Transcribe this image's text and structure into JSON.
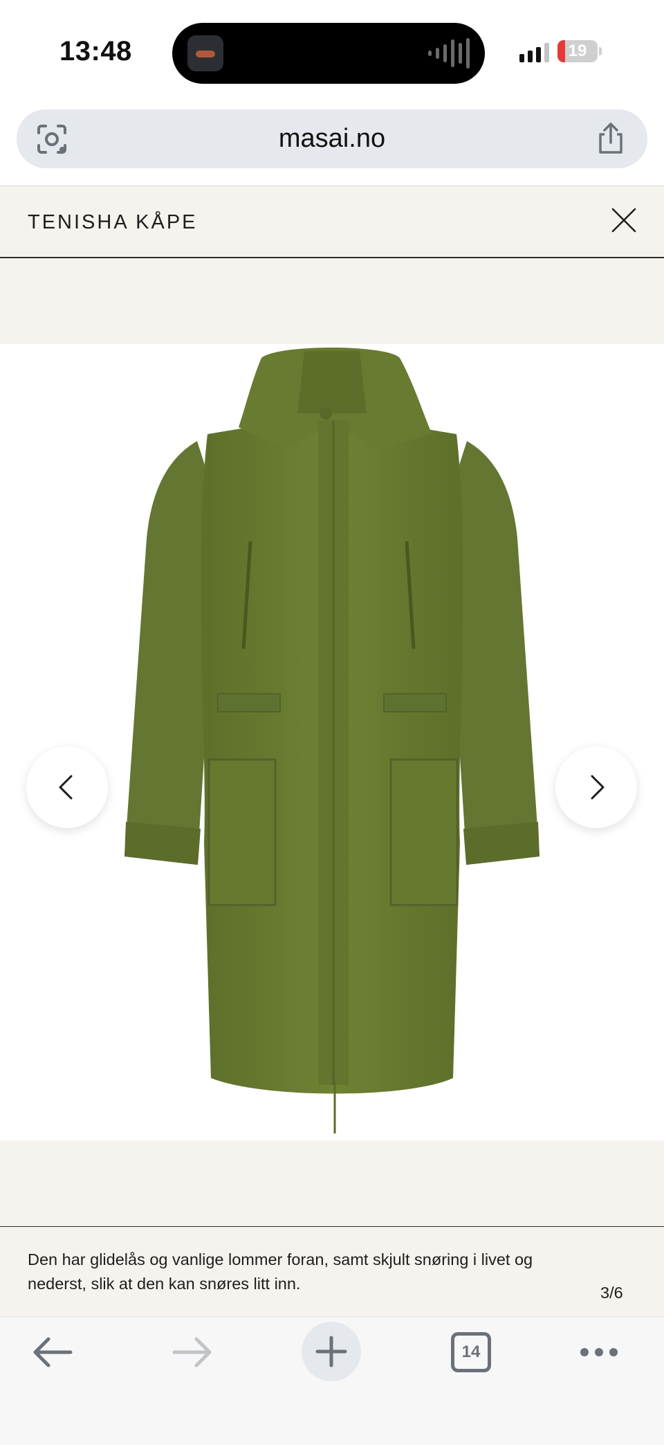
{
  "status_bar": {
    "time": "13:48",
    "battery": {
      "level": "19",
      "level_fraction": 0.19,
      "color": "#e53935"
    },
    "signal_bars_active": 3,
    "island_activity_icon": "audio-waveform-icon"
  },
  "browser": {
    "url": "masai.no",
    "lens_icon": "camera-lens-icon",
    "share_icon": "share-icon"
  },
  "modal": {
    "title": "TENISHA KÅPE",
    "close_icon": "close-icon"
  },
  "gallery": {
    "image_subject": "green parka coat",
    "coat_color": "#6b7d32",
    "prev_icon": "chevron-left-icon",
    "next_icon": "chevron-right-icon",
    "caption": "Den har glidelås og vanlige lommer foran, samt skjult snøring i livet og nederst, slik at den kan snøres litt inn.",
    "counter": "3/6"
  },
  "toolbar": {
    "back_icon": "arrow-left-icon",
    "forward_icon": "arrow-right-icon",
    "new_tab_icon": "plus-icon",
    "tab_count": "14",
    "more_icon": "ellipsis-icon"
  },
  "colors": {
    "page_bg": "#f6f3ee",
    "url_bar_bg": "#e5e8ec",
    "toolbar_bg": "#f7f7f8"
  }
}
